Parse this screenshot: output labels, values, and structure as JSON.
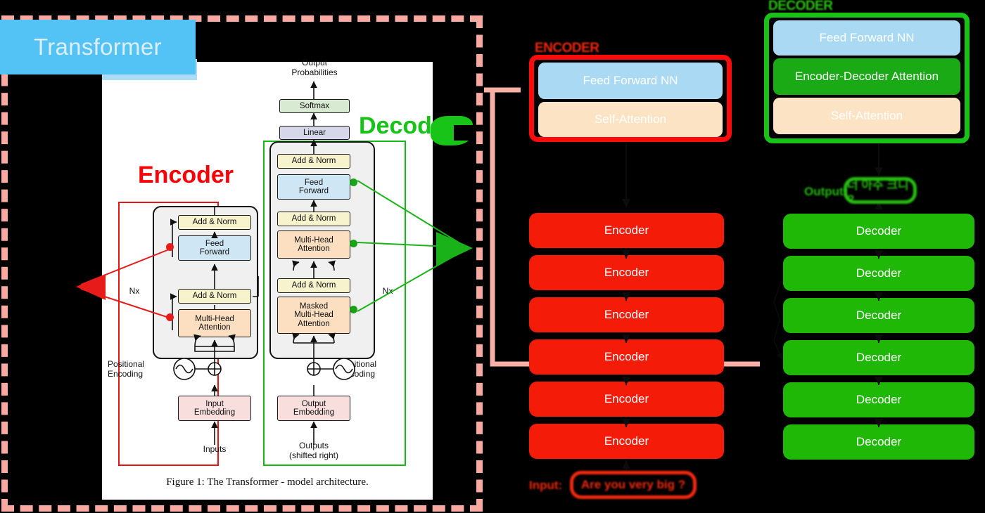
{
  "slide": {
    "title": "Transformer",
    "figure_caption": "Figure 1: The Transformer - model architecture.",
    "label_encoder": "Encoder",
    "label_decoder": "Decoder"
  },
  "figure": {
    "output_probabilities": "Output\nProbabilities",
    "softmax": "Softmax",
    "linear": "Linear",
    "add_norm": "Add & Norm",
    "feed_forward": "Feed\nForward",
    "multi_head_attention": "Multi-Head\nAttention",
    "masked_multi_head_attention": "Masked\nMulti-Head\nAttention",
    "positional_encoding": "Positional\nEncoding",
    "input_embedding": "Input\nEmbedding",
    "output_embedding": "Output\nEmbedding",
    "inputs": "Inputs",
    "outputs_shifted": "Outputs\n(shifted right)",
    "nx": "Nx",
    "nodes": {
      "softmax": "Softmax",
      "linear": "Linear",
      "add_norm": "Add & Norm",
      "feed_forward_l1": "Feed",
      "feed_forward_l2": "Forward",
      "mha_l1": "Multi-Head",
      "mha_l2": "Attention",
      "masked_l1": "Masked",
      "masked_l2": "Multi-Head",
      "masked_l3": "Attention",
      "input_emb_l1": "Input",
      "input_emb_l2": "Embedding",
      "output_emb_l1": "Output",
      "output_emb_l2": "Embedding",
      "pos_enc_l1": "Positional",
      "pos_enc_l2": "Encoding",
      "out_prob_l1": "Output",
      "out_prob_l2": "Probabilities",
      "inputs": "Inputs",
      "outputs_l1": "Outputs",
      "outputs_l2": "(shifted right)"
    }
  },
  "encoder_detail": {
    "heading": "ENCODER",
    "rows": [
      {
        "label": "Feed Forward NN",
        "color": "#aad9f4"
      },
      {
        "label": "Self-Attention",
        "color": "#fce3c4"
      }
    ]
  },
  "decoder_detail": {
    "heading": "DECODER",
    "rows": [
      {
        "label": "Feed Forward NN",
        "color": "#aad9f4"
      },
      {
        "label": "Encoder-Decoder Attention",
        "color": "#1aaa16"
      },
      {
        "label": "Self-Attention",
        "color": "#fce3c4"
      }
    ]
  },
  "stacks": {
    "encoders": [
      "Encoder",
      "Encoder",
      "Encoder",
      "Encoder",
      "Encoder",
      "Encoder"
    ],
    "decoders": [
      "Decoder",
      "Decoder",
      "Decoder",
      "Decoder",
      "Decoder",
      "Decoder"
    ]
  },
  "io": {
    "input_label": "Input:",
    "input_text": "Are you very big ?",
    "output_label": "Output:",
    "output_text": "너 아주 크니 ?"
  },
  "colors": {
    "encoder_red": "#f41b09",
    "decoder_green": "#1fb806",
    "feed_forward_blue": "#aad9f4",
    "self_attention_peach": "#fce3c4",
    "enc_dec_attention_green": "#1aaa16",
    "title_blue": "#53c3f5",
    "pink_border": "#f9a9a0",
    "background": "#000000"
  }
}
